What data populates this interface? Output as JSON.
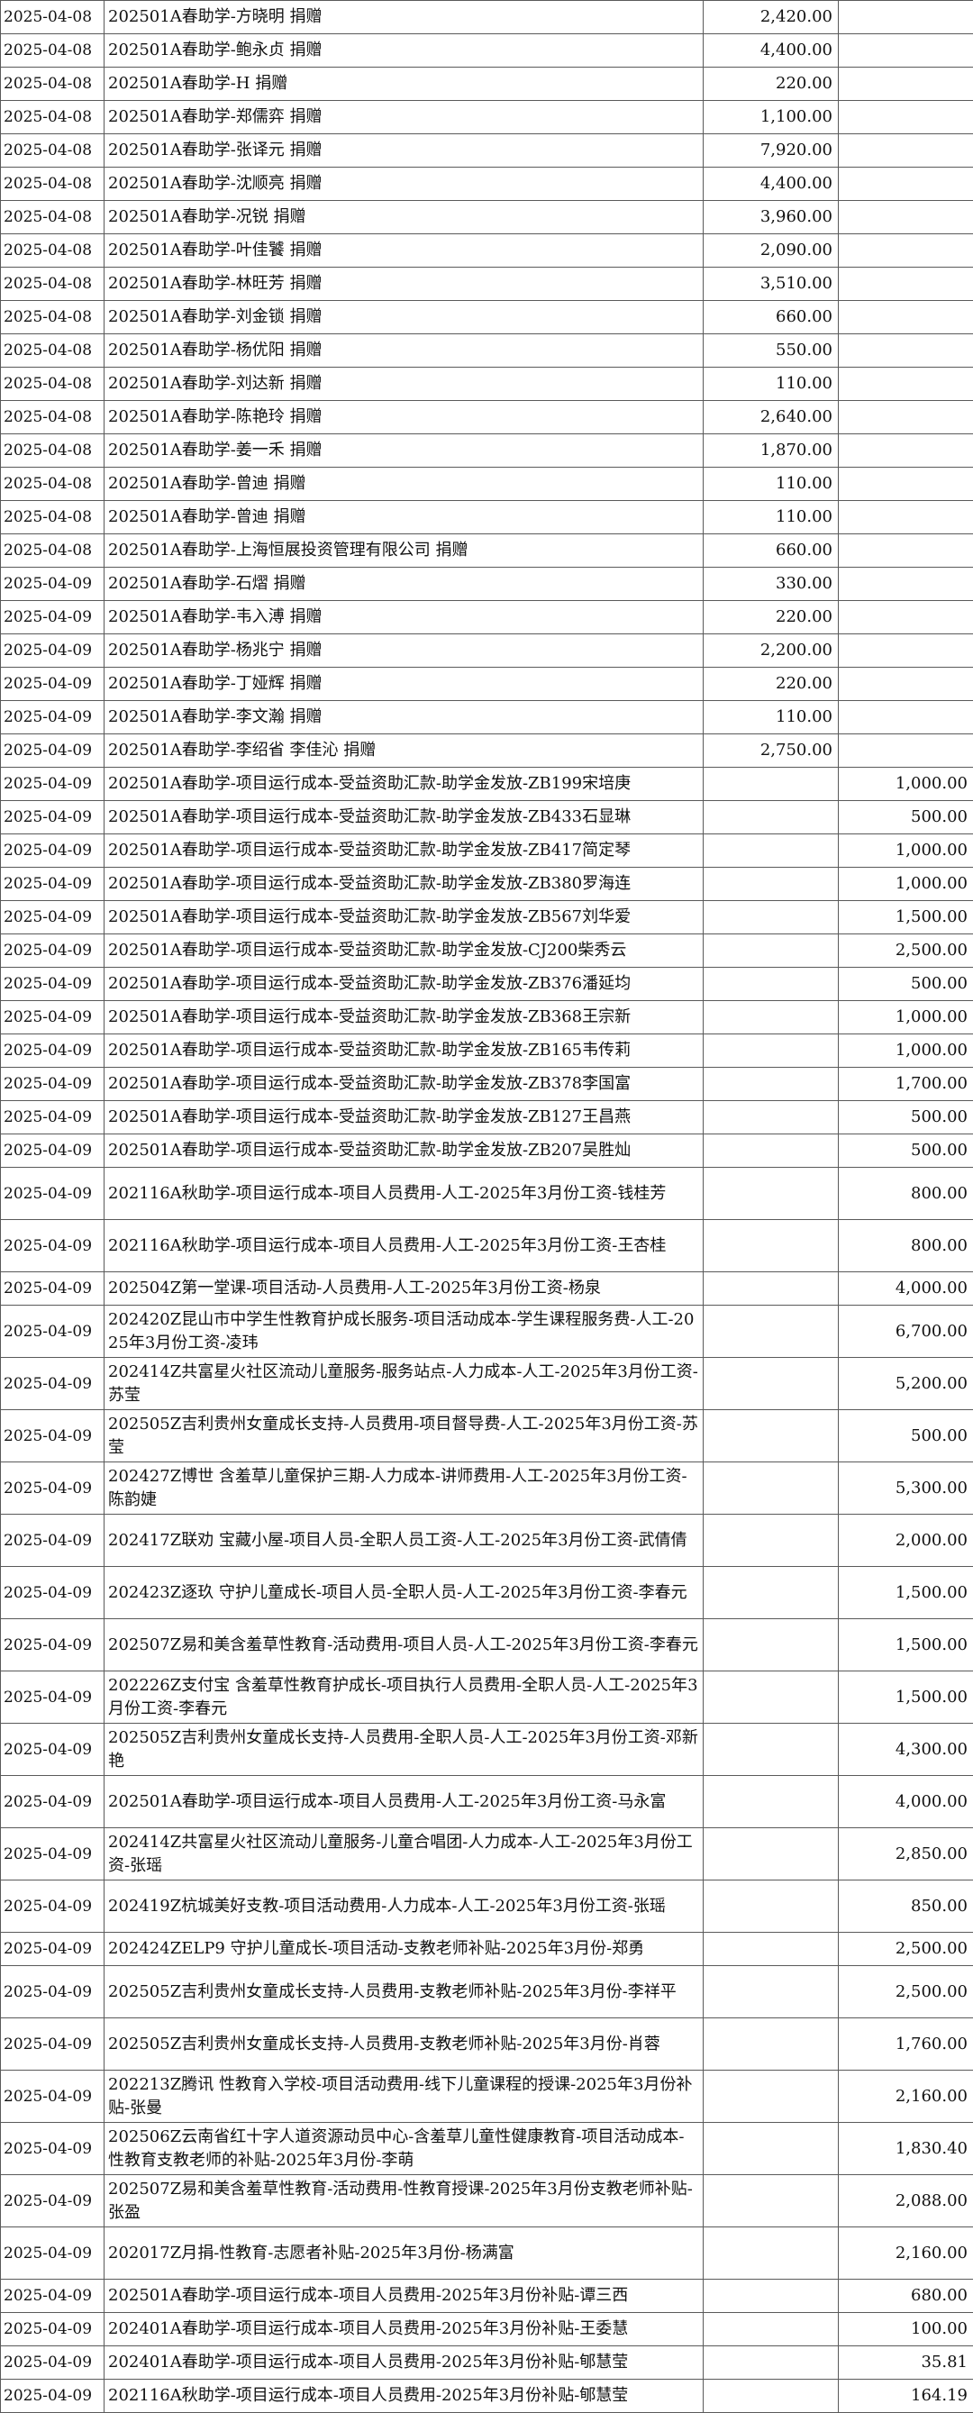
{
  "rows": [
    {
      "date": "2025-04-08",
      "desc": "202501A春助学-方晓明 捐赠",
      "income": "2,420.00",
      "expense": ""
    },
    {
      "date": "2025-04-08",
      "desc": "202501A春助学-鲍永贞 捐赠",
      "income": "4,400.00",
      "expense": ""
    },
    {
      "date": "2025-04-08",
      "desc": "202501A春助学-H 捐赠",
      "income": "220.00",
      "expense": ""
    },
    {
      "date": "2025-04-08",
      "desc": "202501A春助学-郑儒弈 捐赠",
      "income": "1,100.00",
      "expense": ""
    },
    {
      "date": "2025-04-08",
      "desc": "202501A春助学-张译元 捐赠",
      "income": "7,920.00",
      "expense": ""
    },
    {
      "date": "2025-04-08",
      "desc": "202501A春助学-沈顺亮 捐赠",
      "income": "4,400.00",
      "expense": ""
    },
    {
      "date": "2025-04-08",
      "desc": "202501A春助学-况锐 捐赠",
      "income": "3,960.00",
      "expense": ""
    },
    {
      "date": "2025-04-08",
      "desc": "202501A春助学-叶佳饕 捐赠",
      "income": "2,090.00",
      "expense": ""
    },
    {
      "date": "2025-04-08",
      "desc": "202501A春助学-林旺芳 捐赠",
      "income": "3,510.00",
      "expense": ""
    },
    {
      "date": "2025-04-08",
      "desc": "202501A春助学-刘金锁 捐赠",
      "income": "660.00",
      "expense": ""
    },
    {
      "date": "2025-04-08",
      "desc": "202501A春助学-杨优阳 捐赠",
      "income": "550.00",
      "expense": ""
    },
    {
      "date": "2025-04-08",
      "desc": "202501A春助学-刘达新 捐赠",
      "income": "110.00",
      "expense": ""
    },
    {
      "date": "2025-04-08",
      "desc": "202501A春助学-陈艳玲 捐赠",
      "income": "2,640.00",
      "expense": ""
    },
    {
      "date": "2025-04-08",
      "desc": "202501A春助学-姜一禾 捐赠",
      "income": "1,870.00",
      "expense": ""
    },
    {
      "date": "2025-04-08",
      "desc": "202501A春助学-曾迪 捐赠",
      "income": "110.00",
      "expense": ""
    },
    {
      "date": "2025-04-08",
      "desc": "202501A春助学-曾迪 捐赠",
      "income": "110.00",
      "expense": ""
    },
    {
      "date": "2025-04-08",
      "desc": "202501A春助学-上海恒展投资管理有限公司 捐赠",
      "income": "660.00",
      "expense": ""
    },
    {
      "date": "2025-04-09",
      "desc": "202501A春助学-石熠 捐赠",
      "income": "330.00",
      "expense": ""
    },
    {
      "date": "2025-04-09",
      "desc": "202501A春助学-韦入溥 捐赠",
      "income": "220.00",
      "expense": ""
    },
    {
      "date": "2025-04-09",
      "desc": "202501A春助学-杨兆宁 捐赠",
      "income": "2,200.00",
      "expense": ""
    },
    {
      "date": "2025-04-09",
      "desc": "202501A春助学-丁娅辉 捐赠",
      "income": "220.00",
      "expense": ""
    },
    {
      "date": "2025-04-09",
      "desc": "202501A春助学-李文瀚 捐赠",
      "income": "110.00",
      "expense": ""
    },
    {
      "date": "2025-04-09",
      "desc": "202501A春助学-李绍省 李佳沁 捐赠",
      "income": "2,750.00",
      "expense": ""
    },
    {
      "date": "2025-04-09",
      "desc": "202501A春助学-项目运行成本-受益资助汇款-助学金发放-ZB199宋培庚",
      "income": "",
      "expense": "1,000.00"
    },
    {
      "date": "2025-04-09",
      "desc": "202501A春助学-项目运行成本-受益资助汇款-助学金发放-ZB433石显琳",
      "income": "",
      "expense": "500.00"
    },
    {
      "date": "2025-04-09",
      "desc": "202501A春助学-项目运行成本-受益资助汇款-助学金发放-ZB417简定琴",
      "income": "",
      "expense": "1,000.00"
    },
    {
      "date": "2025-04-09",
      "desc": "202501A春助学-项目运行成本-受益资助汇款-助学金发放-ZB380罗海连",
      "income": "",
      "expense": "1,000.00"
    },
    {
      "date": "2025-04-09",
      "desc": "202501A春助学-项目运行成本-受益资助汇款-助学金发放-ZB567刘华爱",
      "income": "",
      "expense": "1,500.00"
    },
    {
      "date": "2025-04-09",
      "desc": "202501A春助学-项目运行成本-受益资助汇款-助学金发放-CJ200柴秀云",
      "income": "",
      "expense": "2,500.00"
    },
    {
      "date": "2025-04-09",
      "desc": "202501A春助学-项目运行成本-受益资助汇款-助学金发放-ZB376潘延均",
      "income": "",
      "expense": "500.00"
    },
    {
      "date": "2025-04-09",
      "desc": "202501A春助学-项目运行成本-受益资助汇款-助学金发放-ZB368王宗新",
      "income": "",
      "expense": "1,000.00"
    },
    {
      "date": "2025-04-09",
      "desc": "202501A春助学-项目运行成本-受益资助汇款-助学金发放-ZB165韦传莉",
      "income": "",
      "expense": "1,000.00"
    },
    {
      "date": "2025-04-09",
      "desc": "202501A春助学-项目运行成本-受益资助汇款-助学金发放-ZB378李国富",
      "income": "",
      "expense": "1,700.00"
    },
    {
      "date": "2025-04-09",
      "desc": "202501A春助学-项目运行成本-受益资助汇款-助学金发放-ZB127王昌燕",
      "income": "",
      "expense": "500.00"
    },
    {
      "date": "2025-04-09",
      "desc": "202501A春助学-项目运行成本-受益资助汇款-助学金发放-ZB207吴胜灿",
      "income": "",
      "expense": "500.00"
    },
    {
      "date": "2025-04-09",
      "desc": "202116A秋助学-项目运行成本-项目人员费用-人工-2025年3月份工资-钱桂芳",
      "income": "",
      "expense": "800.00"
    },
    {
      "date": "2025-04-09",
      "desc": "202116A秋助学-项目运行成本-项目人员费用-人工-2025年3月份工资-王杏桂",
      "income": "",
      "expense": "800.00"
    },
    {
      "date": "2025-04-09",
      "desc": "202504Z第一堂课-项目活动-人员费用-人工-2025年3月份工资-杨泉",
      "income": "",
      "expense": "4,000.00"
    },
    {
      "date": "2025-04-09",
      "desc": "202420Z昆山市中学生性教育护成长服务-项目活动成本-学生课程服务费-人工-2025年3月份工资-凌玮",
      "income": "",
      "expense": "6,700.00"
    },
    {
      "date": "2025-04-09",
      "desc": "202414Z共富星火社区流动儿童服务-服务站点-人力成本-人工-2025年3月份工资-苏莹",
      "income": "",
      "expense": "5,200.00"
    },
    {
      "date": "2025-04-09",
      "desc": "202505Z吉利贵州女童成长支持-人员费用-项目督导费-人工-2025年3月份工资-苏莹",
      "income": "",
      "expense": "500.00"
    },
    {
      "date": "2025-04-09",
      "desc": "202427Z博世 含羞草儿童保护三期-人力成本-讲师费用-人工-2025年3月份工资-陈韵婕",
      "income": "",
      "expense": "5,300.00"
    },
    {
      "date": "2025-04-09",
      "desc": "202417Z联劝 宝藏小屋-项目人员-全职人员工资-人工-2025年3月份工资-武倩倩",
      "income": "",
      "expense": "2,000.00"
    },
    {
      "date": "2025-04-09",
      "desc": "202423Z逐玖 守护儿童成长-项目人员-全职人员-人工-2025年3月份工资-李春元",
      "income": "",
      "expense": "1,500.00"
    },
    {
      "date": "2025-04-09",
      "desc": "202507Z易和美含羞草性教育-活动费用-项目人员-人工-2025年3月份工资-李春元",
      "income": "",
      "expense": "1,500.00"
    },
    {
      "date": "2025-04-09",
      "desc": "202226Z支付宝 含羞草性教育护成长-项目执行人员费用-全职人员-人工-2025年3月份工资-李春元",
      "income": "",
      "expense": "1,500.00"
    },
    {
      "date": "2025-04-09",
      "desc": "202505Z吉利贵州女童成长支持-人员费用-全职人员-人工-2025年3月份工资-邓新艳",
      "income": "",
      "expense": "4,300.00"
    },
    {
      "date": "2025-04-09",
      "desc": "202501A春助学-项目运行成本-项目人员费用-人工-2025年3月份工资-马永富",
      "income": "",
      "expense": "4,000.00"
    },
    {
      "date": "2025-04-09",
      "desc": "202414Z共富星火社区流动儿童服务-儿童合唱团-人力成本-人工-2025年3月份工资-张瑶",
      "income": "",
      "expense": "2,850.00"
    },
    {
      "date": "2025-04-09",
      "desc": "202419Z杭城美好支教-项目活动费用-人力成本-人工-2025年3月份工资-张瑶",
      "income": "",
      "expense": "850.00"
    },
    {
      "date": "2025-04-09",
      "desc": "202424ZELP9 守护儿童成长-项目活动-支教老师补贴-2025年3月份-郑勇",
      "income": "",
      "expense": "2,500.00"
    },
    {
      "date": "2025-04-09",
      "desc": "202505Z吉利贵州女童成长支持-人员费用-支教老师补贴-2025年3月份-李祥平",
      "income": "",
      "expense": "2,500.00"
    },
    {
      "date": "2025-04-09",
      "desc": "202505Z吉利贵州女童成长支持-人员费用-支教老师补贴-2025年3月份-肖蓉",
      "income": "",
      "expense": "1,760.00"
    },
    {
      "date": "2025-04-09",
      "desc": "202213Z腾讯 性教育入学校-项目活动费用-线下儿童课程的授课-2025年3月份补贴-张曼",
      "income": "",
      "expense": "2,160.00"
    },
    {
      "date": "2025-04-09",
      "desc": "202506Z云南省红十字人道资源动员中心-含羞草儿童性健康教育-项目活动成本-性教育支教老师的补贴-2025年3月份-李萌",
      "income": "",
      "expense": "1,830.40"
    },
    {
      "date": "2025-04-09",
      "desc": "202507Z易和美含羞草性教育-活动费用-性教育授课-2025年3月份支教老师补贴-张盈",
      "income": "",
      "expense": "2,088.00"
    },
    {
      "date": "2025-04-09",
      "desc": "202017Z月捐-性教育-志愿者补贴-2025年3月份-杨满富",
      "income": "",
      "expense": "2,160.00"
    },
    {
      "date": "2025-04-09",
      "desc": "202501A春助学-项目运行成本-项目人员费用-2025年3月份补贴-谭三西",
      "income": "",
      "expense": "680.00"
    },
    {
      "date": "2025-04-09",
      "desc": "202401A春助学-项目运行成本-项目人员费用-2025年3月份补贴-王委慧",
      "income": "",
      "expense": "100.00"
    },
    {
      "date": "2025-04-09",
      "desc": "202401A春助学-项目运行成本-项目人员费用-2025年3月份补贴-郇慧莹",
      "income": "",
      "expense": "35.81"
    },
    {
      "date": "2025-04-09",
      "desc": "202116A秋助学-项目运行成本-项目人员费用-2025年3月份补贴-郇慧莹",
      "income": "",
      "expense": "164.19"
    }
  ]
}
